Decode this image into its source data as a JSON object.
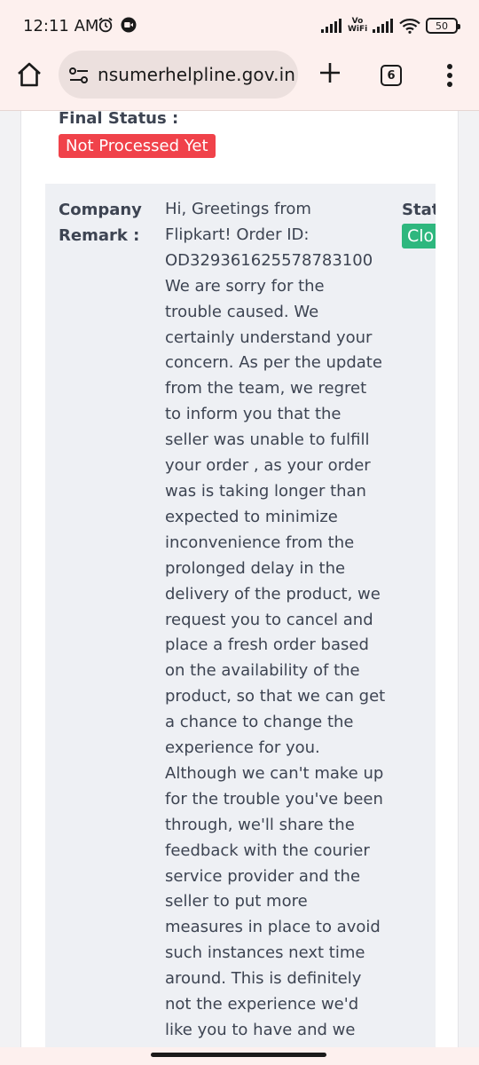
{
  "status_bar": {
    "time": "12:11 AM",
    "network": "Vo WiFi",
    "battery": "50",
    "icons": [
      "alarm-icon",
      "video-record-icon",
      "signal-icon",
      "wifi-icon",
      "battery-icon"
    ]
  },
  "browser": {
    "url": "nsumerhelpline.gov.in",
    "tab_count": "6",
    "icons": [
      "home-icon",
      "site-settings-icon",
      "new-tab-plus-icon",
      "more-menu-icon"
    ]
  },
  "grievance": {
    "final_status_label": "Final Status :",
    "final_status_value": "Not Processed Yet",
    "company_remark_label_1": "Company",
    "company_remark_label_2": "Remark :",
    "remark_lines": [
      "Hi, Greetings from",
      "Flipkart! Order ID:",
      "OD329361625578783100",
      "We are sorry for the",
      "trouble caused. We",
      "certainly understand your",
      "concern. As per the update",
      "from the team, we regret",
      "to inform you that the",
      "seller was unable to fulfill",
      "your order , as your order",
      "was is taking longer than",
      "expected to minimize",
      "inconvenience from the",
      "prolonged delay in the",
      "delivery of the product, we",
      "request you to cancel and",
      "place a fresh order based",
      "on the availability of the",
      "product, so that we can get",
      "a chance to change the",
      "experience for you.",
      "Although we can't make up",
      "for the trouble you've been",
      "through, we'll share the",
      "feedback with the courier",
      "service provider and the",
      "seller to put more",
      "measures in place to avoid",
      "such instances next time",
      "around. This is definitely",
      "not the experience we'd",
      "like you to have and we"
    ],
    "status_column_label": "Stat",
    "status_column_value": "Clo"
  },
  "colors": {
    "chrome_bg": "#fdf0ee",
    "url_bar_bg": "#ece0de",
    "danger_badge": "#f0424a",
    "success_badge": "#2eb77e",
    "text": "#3d4452"
  }
}
